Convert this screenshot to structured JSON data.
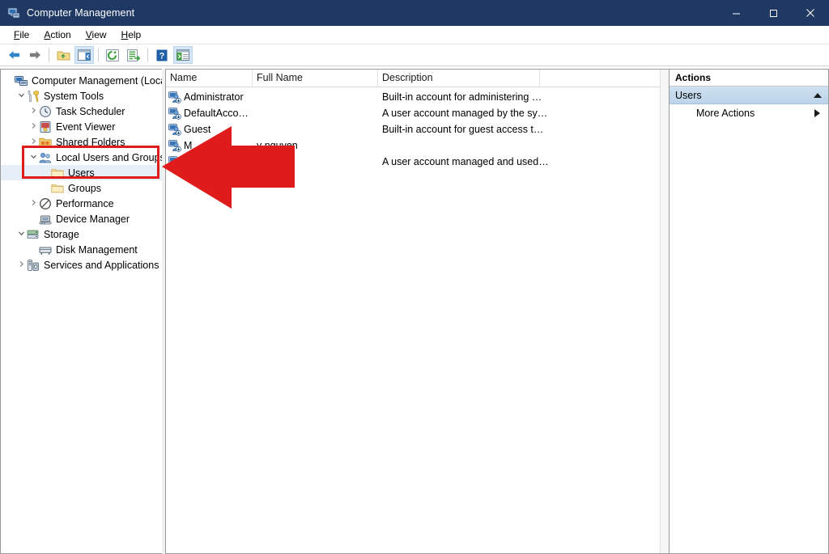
{
  "window": {
    "title": "Computer Management",
    "icon": "computer-management-icon",
    "titlebar_color": "#1f3864",
    "controls": [
      {
        "name": "minimize",
        "glyph": "minimize-icon"
      },
      {
        "name": "maximize",
        "glyph": "maximize-icon"
      },
      {
        "name": "close",
        "glyph": "close-icon"
      }
    ]
  },
  "menubar": {
    "items": [
      {
        "label": "File",
        "accel": "F"
      },
      {
        "label": "Action",
        "accel": "A"
      },
      {
        "label": "View",
        "accel": "V"
      },
      {
        "label": "Help",
        "accel": "H"
      }
    ]
  },
  "toolbar": {
    "buttons": [
      {
        "name": "back-icon"
      },
      {
        "name": "forward-icon"
      },
      {
        "name": "up-folder-icon"
      },
      {
        "name": "show-hide-tree-icon"
      },
      {
        "name": "refresh-icon"
      },
      {
        "name": "export-list-icon"
      },
      {
        "name": "help-icon"
      },
      {
        "name": "show-action-pane-icon"
      }
    ]
  },
  "tree": {
    "nodes": [
      {
        "label": "Computer Management (Local)",
        "indent": 0,
        "twist": "",
        "icon": "computer-icon",
        "selected": false
      },
      {
        "label": "System Tools",
        "indent": 1,
        "twist": "expanded",
        "icon": "system-tools-icon",
        "selected": false
      },
      {
        "label": "Task Scheduler",
        "indent": 2,
        "twist": "collapsed",
        "icon": "clock-icon",
        "selected": false
      },
      {
        "label": "Event Viewer",
        "indent": 2,
        "twist": "collapsed",
        "icon": "event-viewer-icon",
        "selected": false
      },
      {
        "label": "Shared Folders",
        "indent": 2,
        "twist": "collapsed",
        "icon": "shared-folders-icon",
        "selected": false
      },
      {
        "label": "Local Users and Groups",
        "indent": 2,
        "twist": "expanded",
        "icon": "local-users-groups-icon",
        "selected": false
      },
      {
        "label": "Users",
        "indent": 3,
        "twist": "",
        "icon": "folder-icon",
        "selected": true
      },
      {
        "label": "Groups",
        "indent": 3,
        "twist": "",
        "icon": "folder-icon",
        "selected": false
      },
      {
        "label": "Performance",
        "indent": 2,
        "twist": "collapsed",
        "icon": "performance-icon",
        "selected": false
      },
      {
        "label": "Device Manager",
        "indent": 2,
        "twist": "",
        "icon": "device-manager-icon",
        "selected": false
      },
      {
        "label": "Storage",
        "indent": 1,
        "twist": "expanded",
        "icon": "storage-icon",
        "selected": false
      },
      {
        "label": "Disk Management",
        "indent": 2,
        "twist": "",
        "icon": "disk-management-icon",
        "selected": false
      },
      {
        "label": "Services and Applications",
        "indent": 1,
        "twist": "collapsed",
        "icon": "services-icon",
        "selected": false
      }
    ]
  },
  "list": {
    "columns": [
      {
        "key": "name",
        "label": "Name"
      },
      {
        "key": "full_name",
        "label": "Full Name"
      },
      {
        "key": "description",
        "label": "Description"
      }
    ],
    "rows": [
      {
        "icon": "user-account-icon",
        "name": "Administrator",
        "full_name": "",
        "description": "Built-in account for administering …"
      },
      {
        "icon": "user-account-icon",
        "name": "DefaultAcco…",
        "full_name": "",
        "description": "A user account managed by the sy…"
      },
      {
        "icon": "user-account-icon",
        "name": "Guest",
        "full_name": "",
        "description": "Built-in account for guest access t…"
      },
      {
        "icon": "user-account-icon",
        "name": "M",
        "full_name": "y nguyen",
        "description": ""
      },
      {
        "icon": "user-account-icon",
        "name": "",
        "full_name": "",
        "description": "A user account managed and used…"
      }
    ]
  },
  "actions": {
    "title": "Actions",
    "section_label": "Users",
    "section_toggle": "collapse-arrow-icon",
    "items": [
      {
        "label": "More Actions",
        "submenu_icon": "chevron-right-icon"
      }
    ]
  },
  "annotations": {
    "highlight_color": "#e01b1b",
    "box": {
      "target": "local-users-and-groups-users-tree-nodes"
    },
    "arrow": {
      "direction": "left",
      "target": "users-node"
    }
  }
}
